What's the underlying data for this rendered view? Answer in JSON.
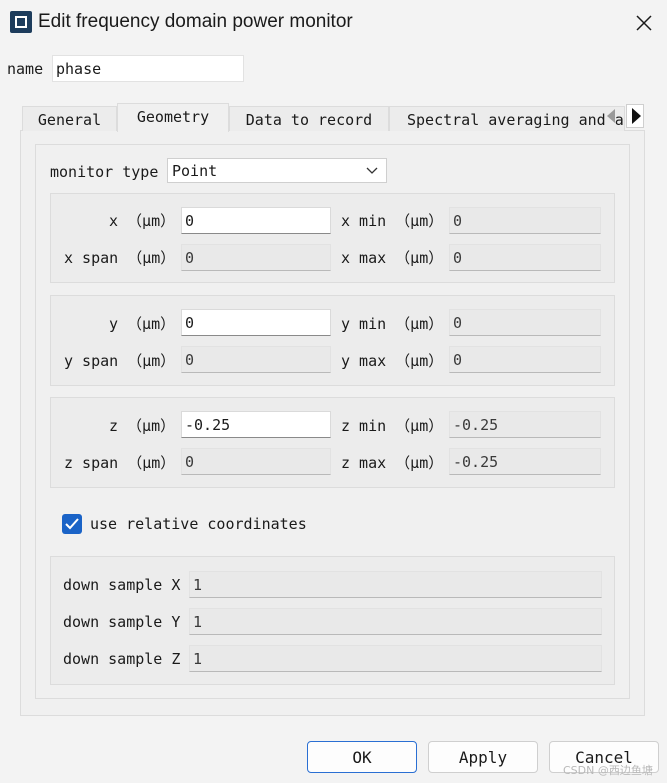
{
  "window": {
    "title": "Edit frequency domain power monitor"
  },
  "name_field": {
    "label": "name",
    "value": "phase"
  },
  "tabs": [
    "General",
    "Geometry",
    "Data to record",
    "Spectral averaging and a"
  ],
  "monitor_type": {
    "label": "monitor type",
    "value": "Point"
  },
  "x_group": {
    "x_label": "x （μm）",
    "x_value": "0",
    "x_min_label": "x min （μm）",
    "x_min_value": "0",
    "x_span_label": "x span （μm）",
    "x_span_value": "0",
    "x_max_label": "x max （μm）",
    "x_max_value": "0"
  },
  "y_group": {
    "y_label": "y （μm）",
    "y_value": "0",
    "y_min_label": "y min （μm）",
    "y_min_value": "0",
    "y_span_label": "y span （μm）",
    "y_span_value": "0",
    "y_max_label": "y max （μm）",
    "y_max_value": "0"
  },
  "z_group": {
    "z_label": "z （μm）",
    "z_value": "-0.25",
    "z_min_label": "z min （μm）",
    "z_min_value": "-0.25",
    "z_span_label": "z span （μm）",
    "z_span_value": "0",
    "z_max_label": "z max （μm）",
    "z_max_value": "-0.25"
  },
  "relative_coords": {
    "label": "use relative coordinates",
    "checked": true
  },
  "down_sample": {
    "x_label": "down sample X",
    "x_value": "1",
    "y_label": "down sample Y",
    "y_value": "1",
    "z_label": "down sample Z",
    "z_value": "1"
  },
  "buttons": {
    "ok": "OK",
    "apply": "Apply",
    "cancel": "Cancel"
  },
  "watermark": "CSDN @西边鱼塘",
  "colors": {
    "accent": "#1a63c7",
    "title_icon": "#1d3c5c"
  },
  "icons": [
    "app-icon",
    "close-icon",
    "chevron-down-icon",
    "check-icon",
    "tab-scroll-left-icon",
    "tab-scroll-right-icon"
  ]
}
